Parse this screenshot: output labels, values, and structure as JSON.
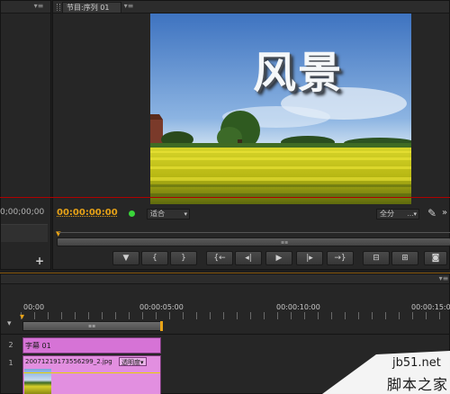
{
  "source_panel": {
    "timecode": "0;00;00;00",
    "add_icon": "+"
  },
  "program_monitor": {
    "tab_label": "节目:序列 01",
    "image_title": "风景",
    "current_timecode": "00:00:00:00",
    "fit_label": "适合",
    "resolution_label": "全分",
    "timeline_marker": "▾",
    "transport_buttons": [
      {
        "name": "add-marker-button",
        "glyph": "▼"
      },
      {
        "name": "mark-in-button",
        "glyph": "{"
      },
      {
        "name": "mark-out-button",
        "glyph": "}"
      },
      {
        "name": "go-to-in-button",
        "glyph": "{←"
      },
      {
        "name": "step-back-button",
        "glyph": "◂|"
      },
      {
        "name": "play-button",
        "glyph": "▶"
      },
      {
        "name": "step-forward-button",
        "glyph": "|▸"
      },
      {
        "name": "go-to-out-button",
        "glyph": "→}"
      },
      {
        "name": "lift-button",
        "glyph": "⊟"
      },
      {
        "name": "extract-button",
        "glyph": "⊞"
      },
      {
        "name": "export-frame-button",
        "glyph": "◙"
      }
    ]
  },
  "timeline": {
    "ruler_labels": [
      "00:00",
      "00:00:05:00",
      "00:00:10:00",
      "00:00:15:00"
    ],
    "tracks": [
      {
        "number": "2",
        "clip_label": "字幕 01"
      },
      {
        "number": "1",
        "clip_label": "20071219173556299_2.jpg",
        "effect_label": "透明度"
      }
    ]
  },
  "watermark": {
    "site": "jb51.net",
    "brand": "脚本之家"
  },
  "colors": {
    "accent_timecode": "#e8a317",
    "title_clip": "#d673d6",
    "video_clip": "#e28fe0",
    "playhead_red": "#b00000"
  }
}
